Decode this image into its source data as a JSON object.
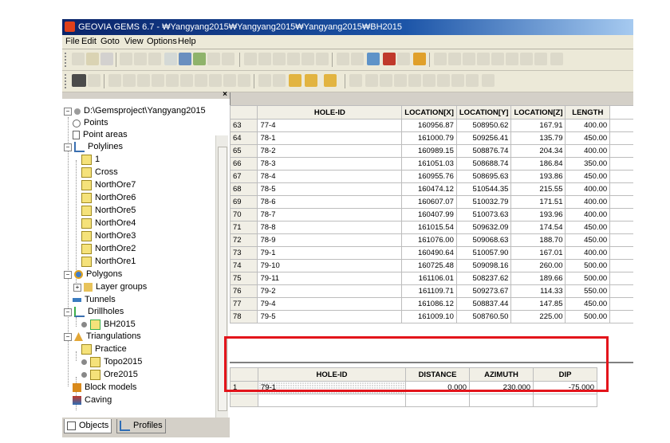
{
  "window": {
    "title": "GEOVIA GEMS 6.7 - ₩Yangyang2015₩Yangyang2015₩Yangyang2015₩BH2015"
  },
  "menu": [
    "File",
    "Edit",
    "Goto",
    "View",
    "Options",
    "Help"
  ],
  "tree": {
    "root": "D:\\Gemsproject\\Yangyang2015",
    "items": {
      "points": "Points",
      "point_areas": "Point areas",
      "polylines": "Polylines",
      "pl_1": "1",
      "pl_cross": "Cross",
      "pl_northore7": "NorthOre7",
      "pl_northore6": "NorthOre6",
      "pl_northore5": "NorthOre5",
      "pl_northore4": "NorthOre4",
      "pl_northore3": "NorthOre3",
      "pl_northore2": "NorthOre2",
      "pl_northore1": "NorthOre1",
      "polygons": "Polygons",
      "layer_groups": "Layer groups",
      "tunnels": "Tunnels",
      "drillholes": "Drillholes",
      "bh2015": "BH2015",
      "triangulations": "Triangulations",
      "practice": "Practice",
      "topo2015": "Topo2015",
      "ore2015": "Ore2015",
      "block_models": "Block models",
      "caving": "Caving"
    }
  },
  "tabs": {
    "objects": "Objects",
    "profiles": "Profiles"
  },
  "grid": {
    "headers": [
      "HOLE-ID",
      "LOCATION[X]",
      "LOCATION[Y]",
      "LOCATION[Z]",
      "LENGTH"
    ],
    "rows": [
      [
        "63",
        "77-4",
        "160956.87",
        "508950.62",
        "167.91",
        "400.00"
      ],
      [
        "64",
        "78-1",
        "161000.79",
        "509256.41",
        "135.79",
        "450.00"
      ],
      [
        "65",
        "78-2",
        "160989.15",
        "508876.74",
        "204.34",
        "400.00"
      ],
      [
        "66",
        "78-3",
        "161051.03",
        "508688.74",
        "186.84",
        "350.00"
      ],
      [
        "67",
        "78-4",
        "160955.76",
        "508695.63",
        "193.86",
        "450.00"
      ],
      [
        "68",
        "78-5",
        "160474.12",
        "510544.35",
        "215.55",
        "400.00"
      ],
      [
        "69",
        "78-6",
        "160607.07",
        "510032.79",
        "171.51",
        "400.00"
      ],
      [
        "70",
        "78-7",
        "160407.99",
        "510073.63",
        "193.96",
        "400.00"
      ],
      [
        "71",
        "78-8",
        "161015.54",
        "509632.09",
        "174.54",
        "450.00"
      ],
      [
        "72",
        "78-9",
        "161076.00",
        "509068.63",
        "188.70",
        "450.00"
      ],
      [
        "73",
        "79-1",
        "160490.64",
        "510057.90",
        "167.01",
        "400.00"
      ],
      [
        "74",
        "79-10",
        "160725.48",
        "509098.16",
        "260.00",
        "500.00"
      ],
      [
        "75",
        "79-11",
        "161106.01",
        "508237.62",
        "189.66",
        "500.00"
      ],
      [
        "76",
        "79-2",
        "161109.71",
        "509273.67",
        "114.33",
        "550.00"
      ],
      [
        "77",
        "79-4",
        "161086.12",
        "508837.44",
        "147.85",
        "450.00"
      ],
      [
        "78",
        "79-5",
        "161009.10",
        "508760.50",
        "225.00",
        "500.00"
      ]
    ]
  },
  "survey_grid": {
    "headers": [
      "HOLE-ID",
      "DISTANCE",
      "AZIMUTH",
      "DIP"
    ],
    "rows": [
      [
        "1",
        "79-1",
        "0.000",
        "230.000",
        "-75.000"
      ]
    ]
  },
  "colors": {
    "highlight_box": "#e3141b",
    "title_bar": "#0a246a"
  }
}
